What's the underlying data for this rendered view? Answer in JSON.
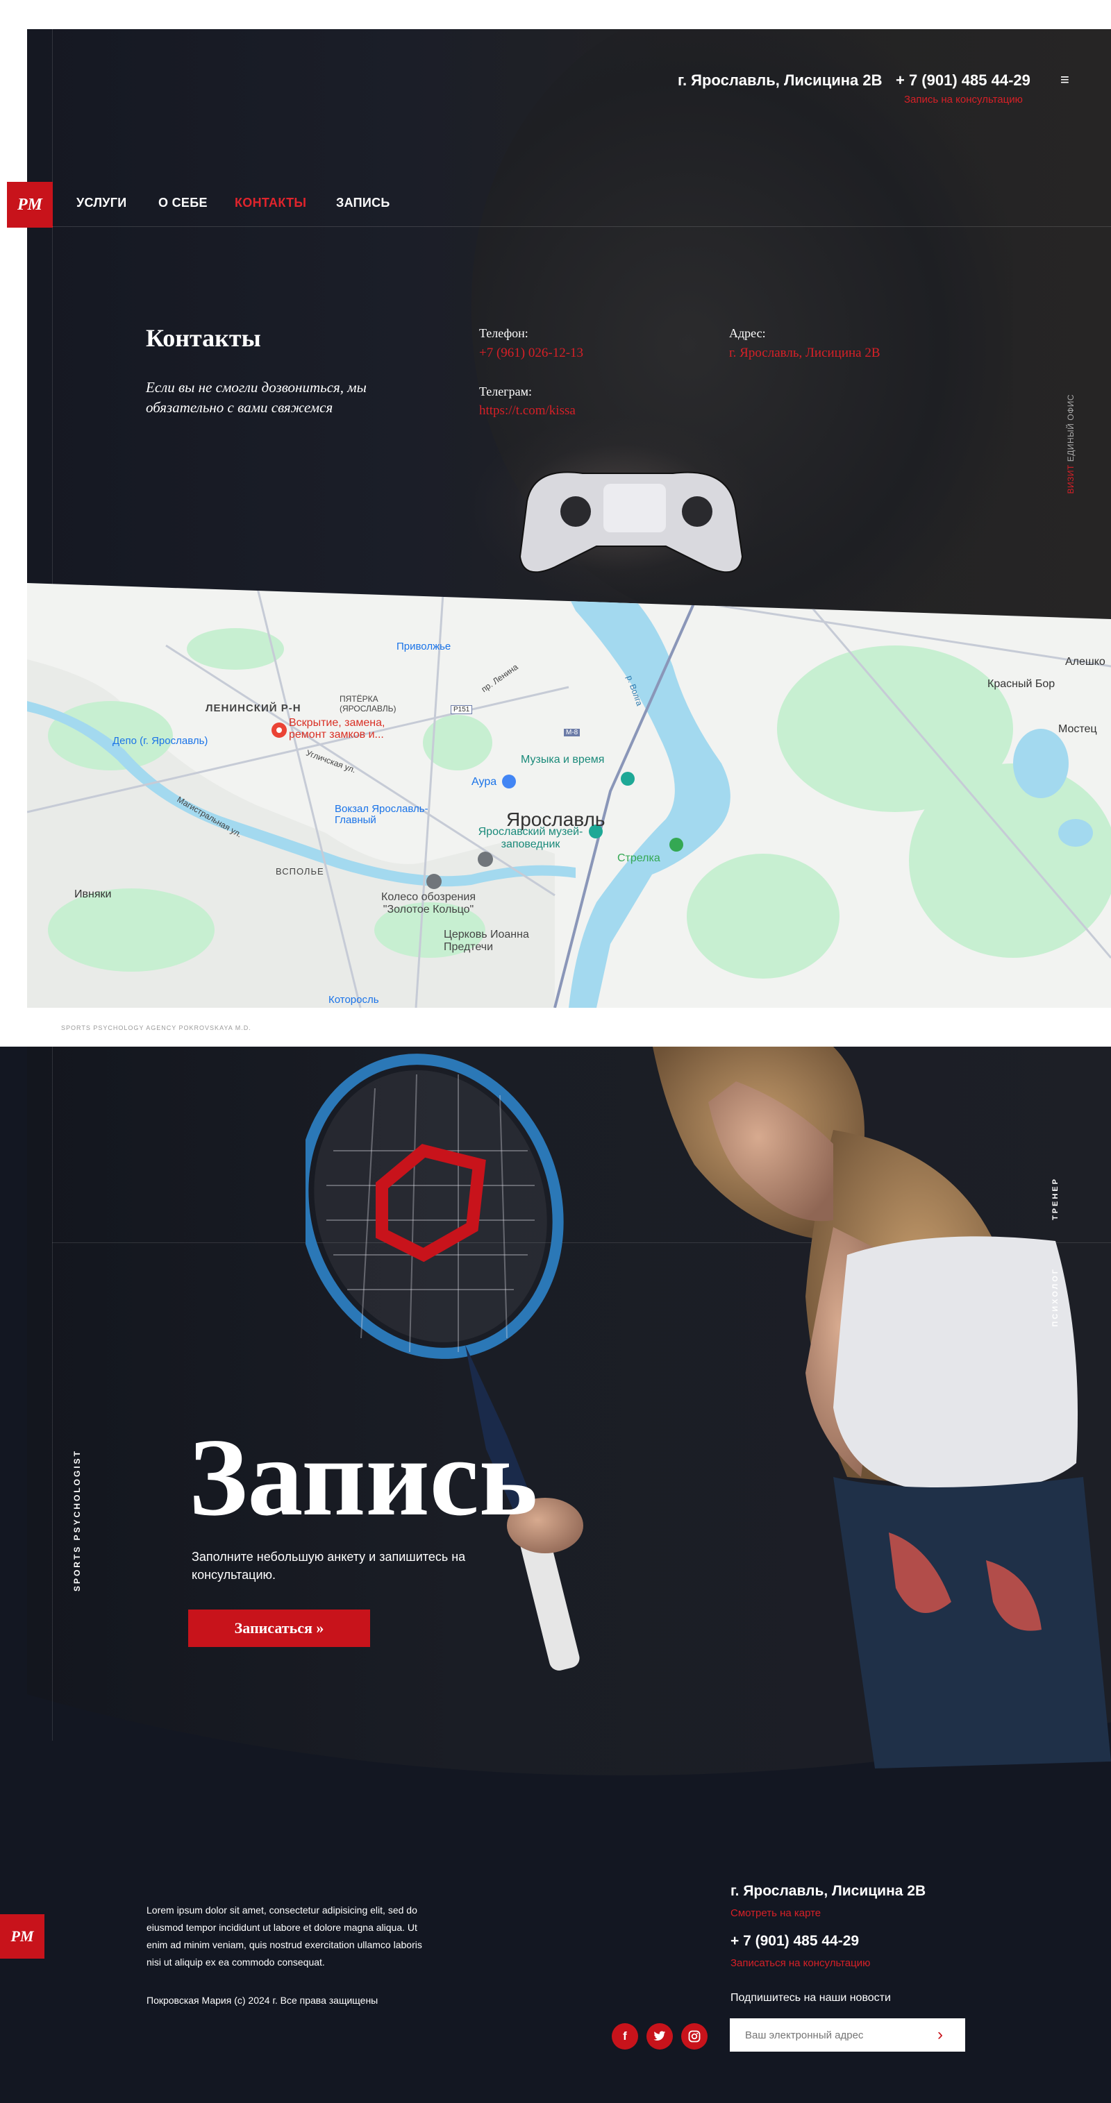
{
  "header": {
    "address": "г. Ярославль, Лисицина 2В",
    "phone": "+ 7 (901) 485 44-29",
    "consult_link": "Запись на консультацию",
    "menu_icon": "≡",
    "logo": "PM"
  },
  "nav": {
    "items": [
      {
        "label": "УСЛУГИ"
      },
      {
        "label": "О СЕБЕ"
      },
      {
        "label": "КОНТАКТЫ"
      },
      {
        "label": "ЗАПИСЬ"
      }
    ],
    "active": "КОНТАКТЫ"
  },
  "contacts": {
    "title": "Контакты",
    "subtitle": "Если вы не смогли дозвониться, мы обязательно с вами свяжемся",
    "phone_label": "Телефон:",
    "phone_value": "+7 (961) 026-12-13",
    "telegram_label": "Телеграм:",
    "telegram_value": "https://t.com/kissa",
    "address_label": "Адрес:",
    "address_value": "г. Ярославль, Лисицина 2В",
    "side_text_red": "ВИЗИТ",
    "side_text": "ЕДИНЫЙ ОФИС"
  },
  "map": {
    "labels": {
      "city": "Ярославль",
      "district": "ЛЕНИНСКИЙ Р-Н",
      "pyaterka": "ПЯТЁРКА (ЯРОСЛАВЛЬ)",
      "pin_place": "Вскрытие, замена, ремонт замков и...",
      "depot": "Депо (г. Ярославль)",
      "privolzhye": "Приволжье",
      "alekhino": "Алешко",
      "krasny_bor": "Красный Бор",
      "mostets": "Мостец",
      "music": "Музыка и время",
      "aura": "Аура",
      "vokzal": "Вокзал Ярославль-Главный",
      "museum": "Ярославский музей- заповедник",
      "strelka": "Стрелка",
      "vspolye": "ВСПОЛЬЕ",
      "wheel": "Колесо обозрения \"Золотое Кольцо\"",
      "church": "Церковь Иоанна Предтечи",
      "ivnyaki": "Ивняки",
      "kotoros": "Которосль",
      "volga": "р. Волга",
      "uglichskaya": "Угличская ул.",
      "lenina": "пр. Ленина",
      "magistral": "Магистральная ул.",
      "p151": "Р151",
      "m8": "М-8"
    }
  },
  "agency_note": "SPORTS PSYCHOLOGY AGENCY POKROVSKAYA M.D.",
  "zapis": {
    "title": "Запись",
    "subtitle": "Заполните небольшую анкету и запишитесь на консультацию.",
    "button": "Записаться »",
    "vertical_left": "SPORTS PSYCHOLOGIST",
    "vertical_right_1": "ТРЕНЕР",
    "vertical_right_2": "ПСИХОЛОГ"
  },
  "footer": {
    "logo": "PM",
    "lorem": "Lorem ipsum dolor sit amet, consectetur adipisicing elit, sed do eiusmod tempor incididunt ut labore et dolore magna aliqua. Ut enim ad minim veniam, quis nostrud exercitation ullamco laboris nisi ut aliquip ex ea commodo consequat.",
    "copyright": "Покровская Мария (c)  2024 г. Все права защищены",
    "address": "г. Ярославль, Лисицина 2В",
    "map_link": "Смотреть на карте",
    "phone": "+ 7 (901) 485 44-29",
    "consult_link": "Записаться на консультацию",
    "newsletter": "Подпишитесь на наши новости",
    "email_placeholder": "Ваш электронный адрес",
    "social": [
      "f",
      "t",
      "ig"
    ]
  },
  "colors": {
    "accent": "#c8131b",
    "dark": "#131722",
    "map_water": "#a3d9ef",
    "map_green": "#c7efd1"
  }
}
